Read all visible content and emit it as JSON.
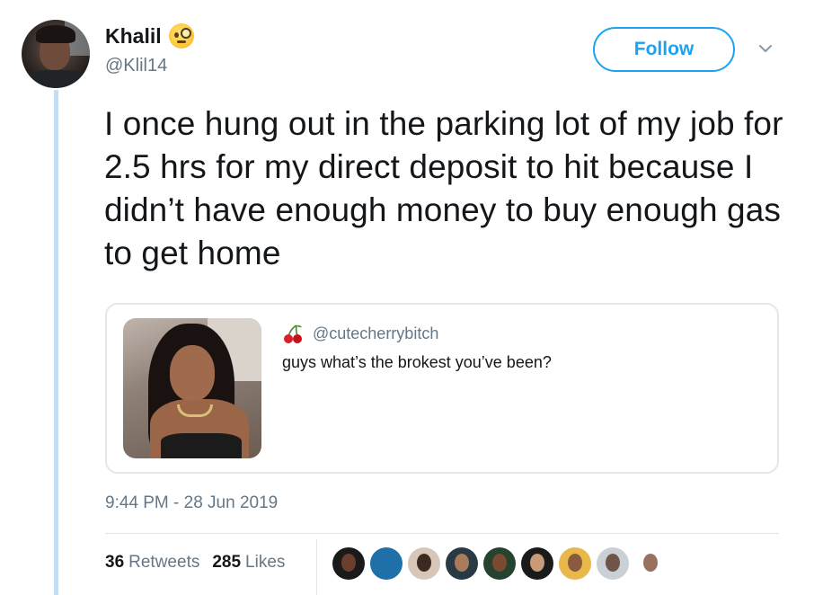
{
  "author": {
    "display_name": "Khalil",
    "emoji": "face-with-monocle-icon",
    "handle": "@Klil14"
  },
  "follow_button": {
    "label": "Follow"
  },
  "tweet_text": "I once hung out in the parking lot of my job for 2.5 hrs for my direct deposit to hit because I didn’t have enough money to buy enough gas to get home",
  "quoted_tweet": {
    "handle": "@cutecherrybitch",
    "icon": "cherry-icon",
    "text": "guys what’s the brokest you’ve been?"
  },
  "timestamp": "9:44 PM - 28 Jun 2019",
  "stats": {
    "retweets_count": "36",
    "retweets_label": "Retweets",
    "likes_count": "285",
    "likes_label": "Likes"
  },
  "likers": [
    {
      "bg": "#1a1a1a",
      "face": "#6b3f2e"
    },
    {
      "bg": "#1f6fa8",
      "face": "#1f6fa8"
    },
    {
      "bg": "#d8c7b8",
      "face": "#3a2a22"
    },
    {
      "bg": "#2a3a44",
      "face": "#a97b5c"
    },
    {
      "bg": "#26432f",
      "face": "#7a4a32"
    },
    {
      "bg": "#1a1a1a",
      "face": "#c99a78"
    },
    {
      "bg": "#e9b84a",
      "face": "#8a5a3e"
    },
    {
      "bg": "#c9d1d6",
      "face": "#6e5548"
    },
    {
      "bg": "#ffffff",
      "face": "#9a7060"
    }
  ],
  "colors": {
    "accent": "#1da1f2",
    "secondary_text": "#657786",
    "thread_line": "#c4dff2"
  }
}
